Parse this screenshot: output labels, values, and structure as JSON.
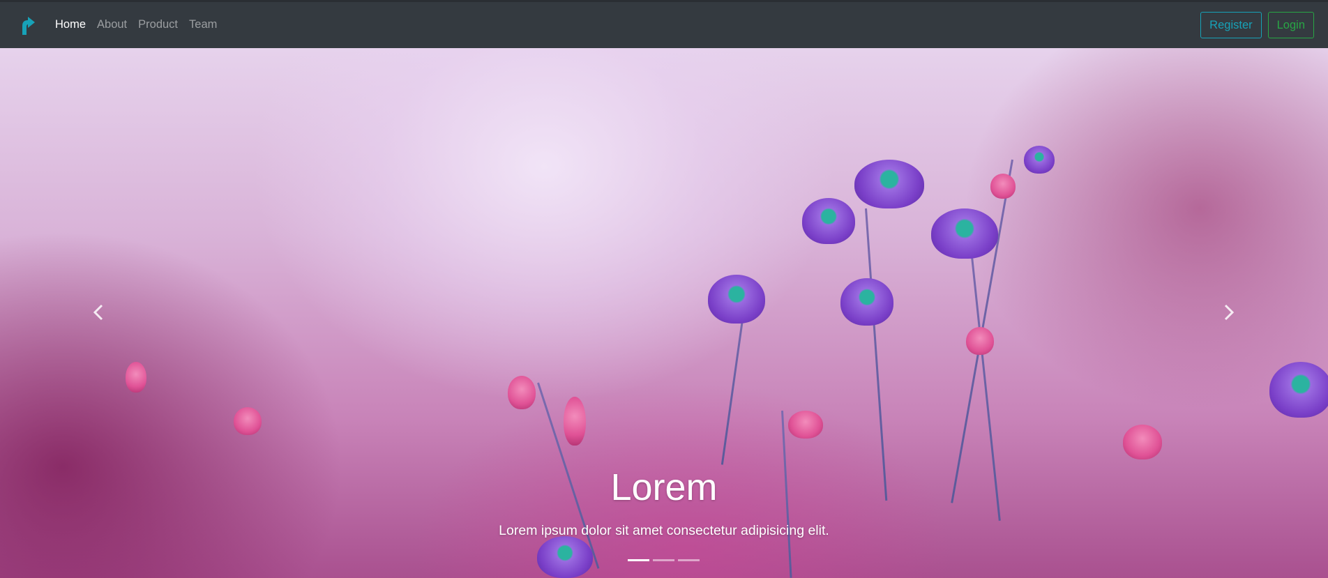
{
  "navbar": {
    "brand_icon": "teal-arrow-logo-icon",
    "links": [
      {
        "label": "Home",
        "active": true
      },
      {
        "label": "About",
        "active": false
      },
      {
        "label": "Product",
        "active": false
      },
      {
        "label": "Team",
        "active": false
      }
    ],
    "register_label": "Register",
    "login_label": "Login"
  },
  "carousel": {
    "caption_title": "Lorem",
    "caption_text": "Lorem ipsum dolor sit amet consectetur adipisicing elit.",
    "prev_icon": "chevron-left-icon",
    "next_icon": "chevron-right-icon",
    "active_slide": 1,
    "slide_count": 3
  },
  "colors": {
    "navbar_bg": "#343a40",
    "brand": "#17a2b8",
    "register": "#17a2b8",
    "login": "#28a745"
  }
}
